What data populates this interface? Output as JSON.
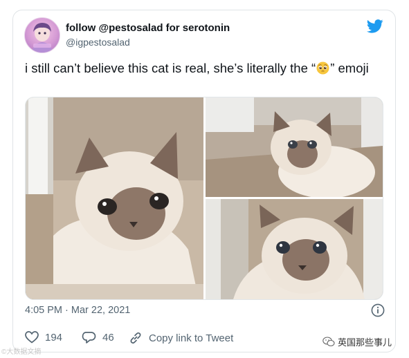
{
  "tweet": {
    "display_name": "follow @pestosalad for serotonin",
    "handle": "@igpestosalad",
    "text_before_emoji": "i still can’t believe this cat is real, she’s literally the “",
    "text_after_emoji": "” emoji",
    "emoji_icon": "pleading-face-emoji",
    "timestamp": "4:05 PM · Mar 22, 2021",
    "likes": "194",
    "replies": "46",
    "copy_link_label": "Copy link to Tweet"
  },
  "colors": {
    "twitter_blue": "#1d9bf0",
    "secondary_text": "#536471",
    "border": "#dfe3e6"
  },
  "icons": {
    "brand": "twitter-bird-icon",
    "info": "info-icon",
    "like": "heart-icon",
    "reply": "reply-icon",
    "copy": "link-icon"
  },
  "watermarks": {
    "left": "©大数据文摘",
    "right": "英国那些事儿"
  }
}
